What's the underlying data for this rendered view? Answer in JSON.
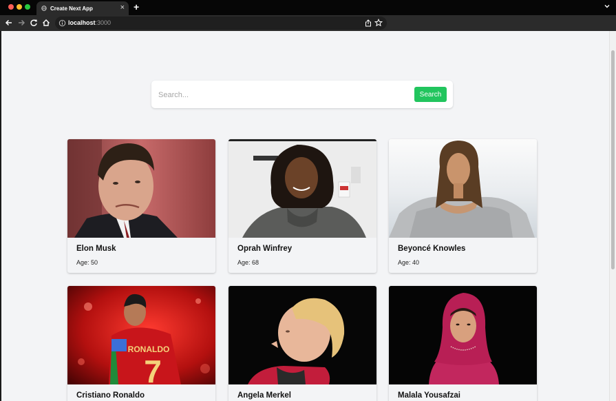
{
  "browser": {
    "tab_title": "Create Next App",
    "tab_close": "×",
    "new_tab": "+",
    "url_host": "localhost",
    "url_port": ":3000"
  },
  "search": {
    "placeholder": "Search...",
    "button_label": "Search"
  },
  "theme": {
    "accent": "#22c55e",
    "page_bg": "#f3f4f6"
  },
  "cards": [
    {
      "name": "Elon Musk",
      "age_label": "Age: 50"
    },
    {
      "name": "Oprah Winfrey",
      "age_label": "Age: 68"
    },
    {
      "name": "Beyoncé Knowles",
      "age_label": "Age: 40"
    },
    {
      "name": "Cristiano Ronaldo",
      "age_label": ""
    },
    {
      "name": "Angela Merkel",
      "age_label": ""
    },
    {
      "name": "Malala Yousafzai",
      "age_label": ""
    }
  ],
  "photo_text": {
    "jersey_name": "RONALDO",
    "jersey_number": "7"
  }
}
